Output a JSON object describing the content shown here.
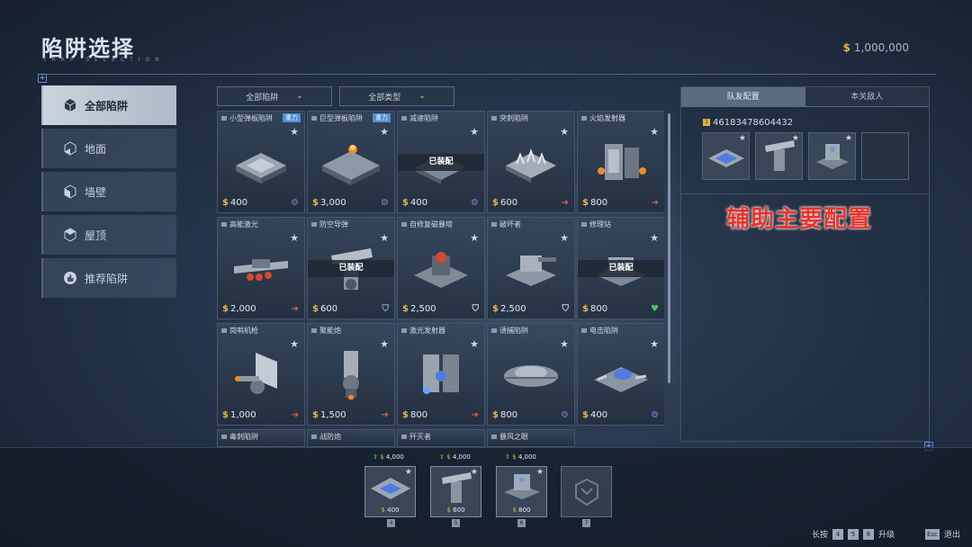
{
  "header": {
    "title": "陷阱选择",
    "subtitle": "TRAP SELECTION",
    "money_symbol": "$",
    "money": "1,000,000"
  },
  "sidebar": {
    "items": [
      {
        "label": "全部陷阱",
        "icon": "cube-icon",
        "active": true
      },
      {
        "label": "地面",
        "icon": "floor-icon"
      },
      {
        "label": "墙壁",
        "icon": "wall-icon"
      },
      {
        "label": "屋顶",
        "icon": "ceiling-icon"
      },
      {
        "label": "推荐陷阱",
        "icon": "thumbs-up-icon"
      }
    ]
  },
  "filters": {
    "trap_filter": "全部陷阱",
    "type_filter": "全部类型"
  },
  "traps": [
    {
      "name": "小型弹板陷阱",
      "tag": "重力",
      "price": "400",
      "action_icon": "gear-icon",
      "equipped": false
    },
    {
      "name": "巨型弹板陷阱",
      "tag": "重力",
      "price": "3,000",
      "action_icon": "gear-icon",
      "equipped": false
    },
    {
      "name": "减速陷阱",
      "tag": "",
      "price": "400",
      "action_icon": "gear-icon",
      "equipped": true
    },
    {
      "name": "突刺陷阱",
      "tag": "",
      "price": "600",
      "action_icon": "arrow-right-icon",
      "equipped": false
    },
    {
      "name": "火焰发射器",
      "tag": "",
      "price": "800",
      "action_icon": "arrow-right-icon",
      "equipped": false
    },
    {
      "name": "高能激光",
      "tag": "",
      "price": "2,000",
      "action_icon": "arrow-right-icon",
      "equipped": false
    },
    {
      "name": "防空导弹",
      "tag": "",
      "price": "600",
      "action_icon": "shield-icon",
      "equipped": true
    },
    {
      "name": "自修复磁暴塔",
      "tag": "",
      "price": "2,500",
      "action_icon": "shield-icon",
      "equipped": false
    },
    {
      "name": "破坏者",
      "tag": "",
      "price": "2,500",
      "action_icon": "shield-icon",
      "equipped": false
    },
    {
      "name": "修理站",
      "tag": "",
      "price": "800",
      "action_icon": "heart-icon",
      "equipped": true
    },
    {
      "name": "岗哨机枪",
      "tag": "",
      "price": "1,000",
      "action_icon": "arrow-right-icon",
      "equipped": false
    },
    {
      "name": "聚能炮",
      "tag": "",
      "price": "1,500",
      "action_icon": "arrow-right-icon",
      "equipped": false
    },
    {
      "name": "激光发射器",
      "tag": "",
      "price": "800",
      "action_icon": "arrow-right-icon",
      "equipped": false
    },
    {
      "name": "诱捕陷阱",
      "tag": "",
      "price": "800",
      "action_icon": "gear-icon",
      "equipped": false
    },
    {
      "name": "电击陷阱",
      "tag": "",
      "price": "400",
      "action_icon": "gear-icon",
      "equipped": false
    },
    {
      "name": "毒刺陷阱",
      "tag": "",
      "price": "",
      "action_icon": "",
      "equipped": false
    },
    {
      "name": "战防炮",
      "tag": "",
      "price": "",
      "action_icon": "",
      "equipped": false
    },
    {
      "name": "歼灭者",
      "tag": "",
      "price": "",
      "action_icon": "",
      "equipped": false
    },
    {
      "name": "暴风之眼",
      "tag": "",
      "price": "",
      "action_icon": "",
      "equipped": false
    }
  ],
  "equipped_label": "已装配",
  "right_panel": {
    "tabs": [
      "队友配置",
      "本关敌人"
    ],
    "player_level": "1",
    "player_id": "46183478604432",
    "annotation": "辅助主要配置"
  },
  "quickbar": {
    "slots": [
      {
        "key": "4",
        "price": "400",
        "upgrade_price": "4,000"
      },
      {
        "key": "5",
        "price": "600",
        "upgrade_price": "4,000"
      },
      {
        "key": "6",
        "price": "800",
        "upgrade_price": "4,000"
      },
      {
        "key": "7",
        "price": "",
        "upgrade_price": ""
      }
    ]
  },
  "hints": {
    "hold_label": "长按",
    "keys": [
      "4",
      "5",
      "6"
    ],
    "upgrade_label": "升级",
    "esc_key": "Esc",
    "exit_label": "退出"
  },
  "colors": {
    "coin": "#e9b24a",
    "tag": "#4b8fd6",
    "arrow": "#e0584a",
    "gear": "#8f7ad6",
    "heart": "#4cc46a",
    "annotation": "#e8342c"
  }
}
